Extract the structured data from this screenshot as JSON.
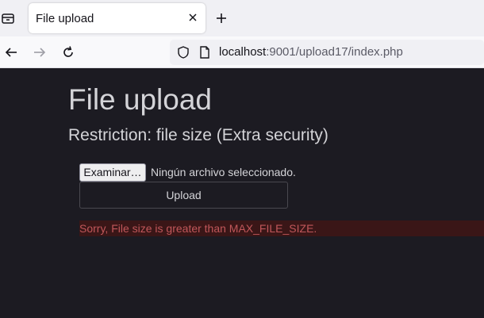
{
  "browser": {
    "tab": {
      "title": "File upload"
    },
    "url": {
      "host": "localhost",
      "path": ":9001/upload17/index.php"
    }
  },
  "page": {
    "title": "File upload",
    "subtitle": "Restriction: file size (Extra security)",
    "file_input": {
      "button_label": "Examinar…",
      "status_text": "Ningún archivo seleccionado."
    },
    "upload_button_label": "Upload",
    "error_message": "Sorry, File size is greater than MAX_FILE_SIZE."
  },
  "colors": {
    "background": "#1c1b22",
    "error_text": "#c0575a",
    "error_background": "#3a1617"
  },
  "icons": [
    "tab-list-icon",
    "close-icon",
    "plus-icon",
    "back-arrow-icon",
    "forward-arrow-icon",
    "reload-icon",
    "shield-icon",
    "page-icon"
  ]
}
